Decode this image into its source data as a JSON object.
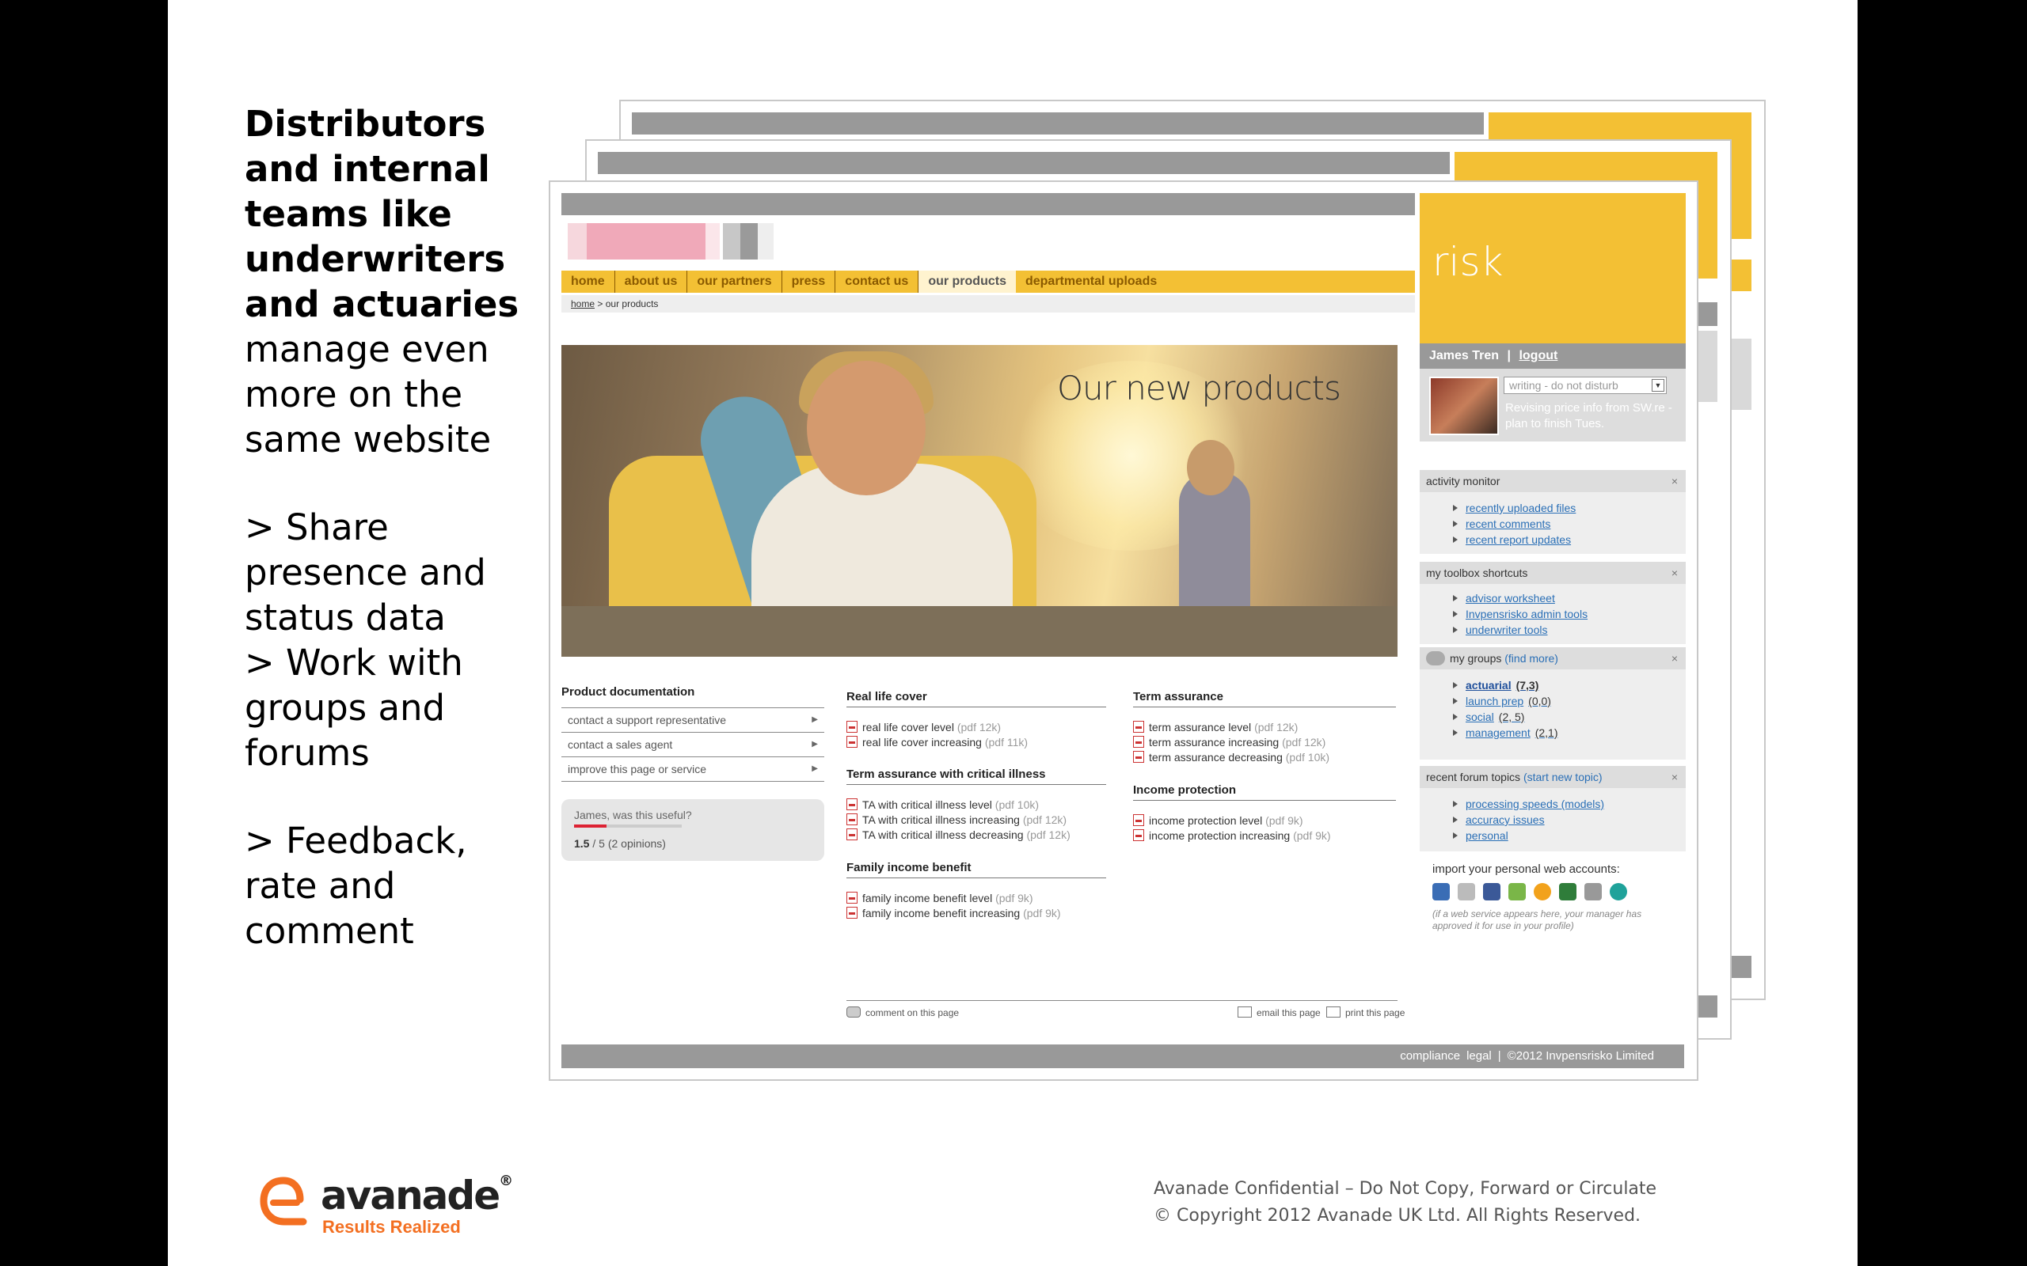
{
  "slide": {
    "heading": "Distributors and internal teams like underwriters and actuaries",
    "intro": "manage even more on the same website",
    "bullets": [
      "> Share presence and status data",
      "> Work with groups and forums",
      "> Feedback, rate and comment"
    ],
    "confidential": "Avanade Confidential – Do Not Copy, Forward or Circulate",
    "copyright": "© Copyright 2012 Avanade UK Ltd. All Rights Reserved.",
    "logo": {
      "word": "avanade",
      "reg": "®",
      "tagline": "Results Realized",
      "icon": "avanade-logo-icon"
    }
  },
  "site": {
    "nav": [
      {
        "label": "home"
      },
      {
        "label": "about us"
      },
      {
        "label": "our partners"
      },
      {
        "label": "press"
      },
      {
        "label": "contact us"
      },
      {
        "label": "our products"
      },
      {
        "label": "departmental uploads"
      }
    ],
    "active_nav": "our products",
    "breadcrumb": {
      "home": "home",
      "sep": " > ",
      "current": "our products"
    },
    "hero_title": "Our new products",
    "product_doc": {
      "title": "Product documentation",
      "items": [
        "contact a support representative",
        "contact a sales agent",
        "improve this page or service"
      ]
    },
    "useful": {
      "question": "James, was this useful?",
      "rating": "1.5",
      "rest": " / 5 (2 opinions)",
      "rating_fraction": 0.3
    },
    "sections": {
      "real_life": {
        "title": "Real life cover",
        "docs": [
          {
            "name": "real life cover level",
            "size": "(pdf 12k)"
          },
          {
            "name": "real life cover increasing",
            "size": "(pdf 11k)"
          }
        ]
      },
      "ta_critical": {
        "title": "Term assurance with critical illness",
        "docs": [
          {
            "name": "TA with critical illness level",
            "size": "(pdf 10k)"
          },
          {
            "name": "TA with critical illness increasing",
            "size": "(pdf 12k)"
          },
          {
            "name": "TA with critical illness decreasing",
            "size": "(pdf 12k)"
          }
        ]
      },
      "family": {
        "title": "Family income benefit",
        "docs": [
          {
            "name": "family income benefit level",
            "size": "(pdf 9k)"
          },
          {
            "name": "family income benefit increasing",
            "size": "(pdf 9k)"
          }
        ]
      },
      "term": {
        "title": "Term assurance",
        "docs": [
          {
            "name": "term assurance level",
            "size": "(pdf 12k)"
          },
          {
            "name": "term assurance increasing",
            "size": "(pdf 12k)"
          },
          {
            "name": "term assurance decreasing",
            "size": "(pdf 10k)"
          }
        ]
      },
      "income": {
        "title": "Income protection",
        "docs": [
          {
            "name": "income protection level",
            "size": "(pdf 9k)"
          },
          {
            "name": "income protection increasing",
            "size": "(pdf 9k)"
          }
        ]
      }
    },
    "bottom_links": {
      "comment": "comment on this page",
      "email": "email this page",
      "print": "print this page"
    },
    "footer": {
      "compliance": "compliance",
      "legal": "legal",
      "sep": "|",
      "copy": "©2012 Invpensrisko Limited"
    },
    "sidebar": {
      "brand": "risk",
      "user": "James Tren",
      "user_sep": "|",
      "logout": "logout",
      "status_select": "writing - do not disturb",
      "status_msg": "Revising price info from SW.re - plan to finish Tues.",
      "close": "×",
      "activity": {
        "title": "activity monitor",
        "items": [
          "recently uploaded files",
          "recent comments",
          "recent report updates"
        ]
      },
      "toolbox": {
        "title": "my toolbox shortcuts",
        "items": [
          "advisor worksheet",
          "Invpensrisko admin tools",
          "underwriter tools"
        ]
      },
      "groups": {
        "title": "my groups",
        "find": "(find more)",
        "items": [
          {
            "name": "actuarial",
            "count": "(7,3)"
          },
          {
            "name": "launch prep",
            "count": "(0,0)"
          },
          {
            "name": "social",
            "count": "(2, 5)"
          },
          {
            "name": "management",
            "count": "(2,1)"
          }
        ]
      },
      "forum": {
        "title": "recent forum topics",
        "start": "(start new topic)",
        "items": [
          "processing speeds (models)",
          "accuracy issues",
          "personal"
        ]
      },
      "import": {
        "title": "import your personal web accounts:",
        "note": "(if a web service appears here, your manager has approved it for use in your profile)"
      }
    }
  }
}
